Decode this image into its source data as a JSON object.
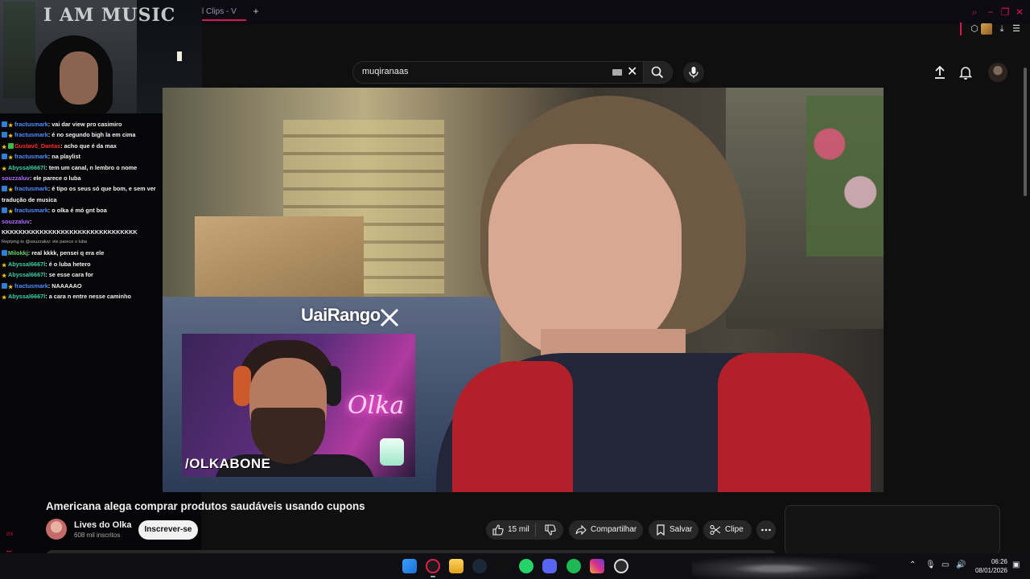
{
  "browser": {
    "tab_title": "icial Clips - V",
    "new_tab": "+"
  },
  "youtube": {
    "search_value": "muqiranaas",
    "video_title": "Americana alega comprar produtos saudáveis usando cupons",
    "channel_name": "Lives do Olka",
    "subscribers": "608 mil inscritos",
    "subscribe_label": "Inscrever-se",
    "likes": "15 mil",
    "share_label": "Compartilhar",
    "save_label": "Salvar",
    "clip_label": "Clipe"
  },
  "video_overlay": {
    "watermark": "UaiRango",
    "facecam_tag": "/OLKABONE",
    "neon_sign": "Olka"
  },
  "webcam": {
    "poster_text": "I AM MUSIC"
  },
  "chat": {
    "messages": [
      {
        "user": "fractusmark",
        "text": "vai dar view pro casimiro",
        "color": "#4f8cff",
        "badges": [
          "blue",
          "star"
        ]
      },
      {
        "user": "fractusmark",
        "text": "é no segundo bigh la em cima",
        "color": "#4f8cff",
        "badges": [
          "blue",
          "star"
        ]
      },
      {
        "user": "Gustav0_Dantas",
        "text": "acho que é da max",
        "color": "#ff2e2e",
        "badges": [
          "star",
          "green"
        ]
      },
      {
        "user": "fractusmark",
        "text": "na playlist",
        "color": "#4f8cff",
        "badges": [
          "blue",
          "star"
        ]
      },
      {
        "user": "Abyssal6667l",
        "text": "tem um canal, n lembro o nome",
        "color": "#3fd0a0",
        "badges": [
          "star"
        ]
      },
      {
        "user": "souzzaluv",
        "text": "ele parece o luba",
        "color": "#b06cff",
        "badges": []
      },
      {
        "user": "fractusmark",
        "text": "é tipo os seus só que bom, e sem ver tradução de musica",
        "color": "#4f8cff",
        "badges": [
          "blue",
          "star"
        ]
      },
      {
        "user": "fractusmark",
        "text": "o olka é mó gnt boa",
        "color": "#4f8cff",
        "badges": [
          "blue",
          "star"
        ]
      },
      {
        "user": "souzzaluv",
        "text": "KKKKKKKKKKKKKKKKKKKKKKKKKKKKKKKK",
        "color": "#b06cff",
        "badges": []
      },
      {
        "reply": "Replying to @souzzaluv: ele parece o luba"
      },
      {
        "user": "Milokkj",
        "text": "real kkkk, pensei q era ele",
        "color": "#6cd36c",
        "badges": [
          "blue"
        ]
      },
      {
        "user": "Abyssal6667l",
        "text": "é o luba hetero",
        "color": "#3fd0a0",
        "badges": [
          "star"
        ]
      },
      {
        "user": "Abyssal6667l",
        "text": "se esse cara for",
        "color": "#3fd0a0",
        "badges": [
          "star"
        ]
      },
      {
        "user": "fractusmark",
        "text": "NAAAAAO",
        "color": "#4f8cff",
        "badges": [
          "blue",
          "star"
        ]
      },
      {
        "user": "Abyssal6667l",
        "text": "a cara n entre nesse caminho",
        "color": "#3fd0a0",
        "badges": [
          "star"
        ]
      }
    ]
  },
  "taskbar": {
    "time": "06:26",
    "date": "08/01/2026",
    "apps": [
      "windows-start",
      "opera-gx",
      "file-explorer",
      "steam",
      "tiktok",
      "whatsapp",
      "discord",
      "spotify",
      "instagram",
      "chrome-like"
    ]
  }
}
